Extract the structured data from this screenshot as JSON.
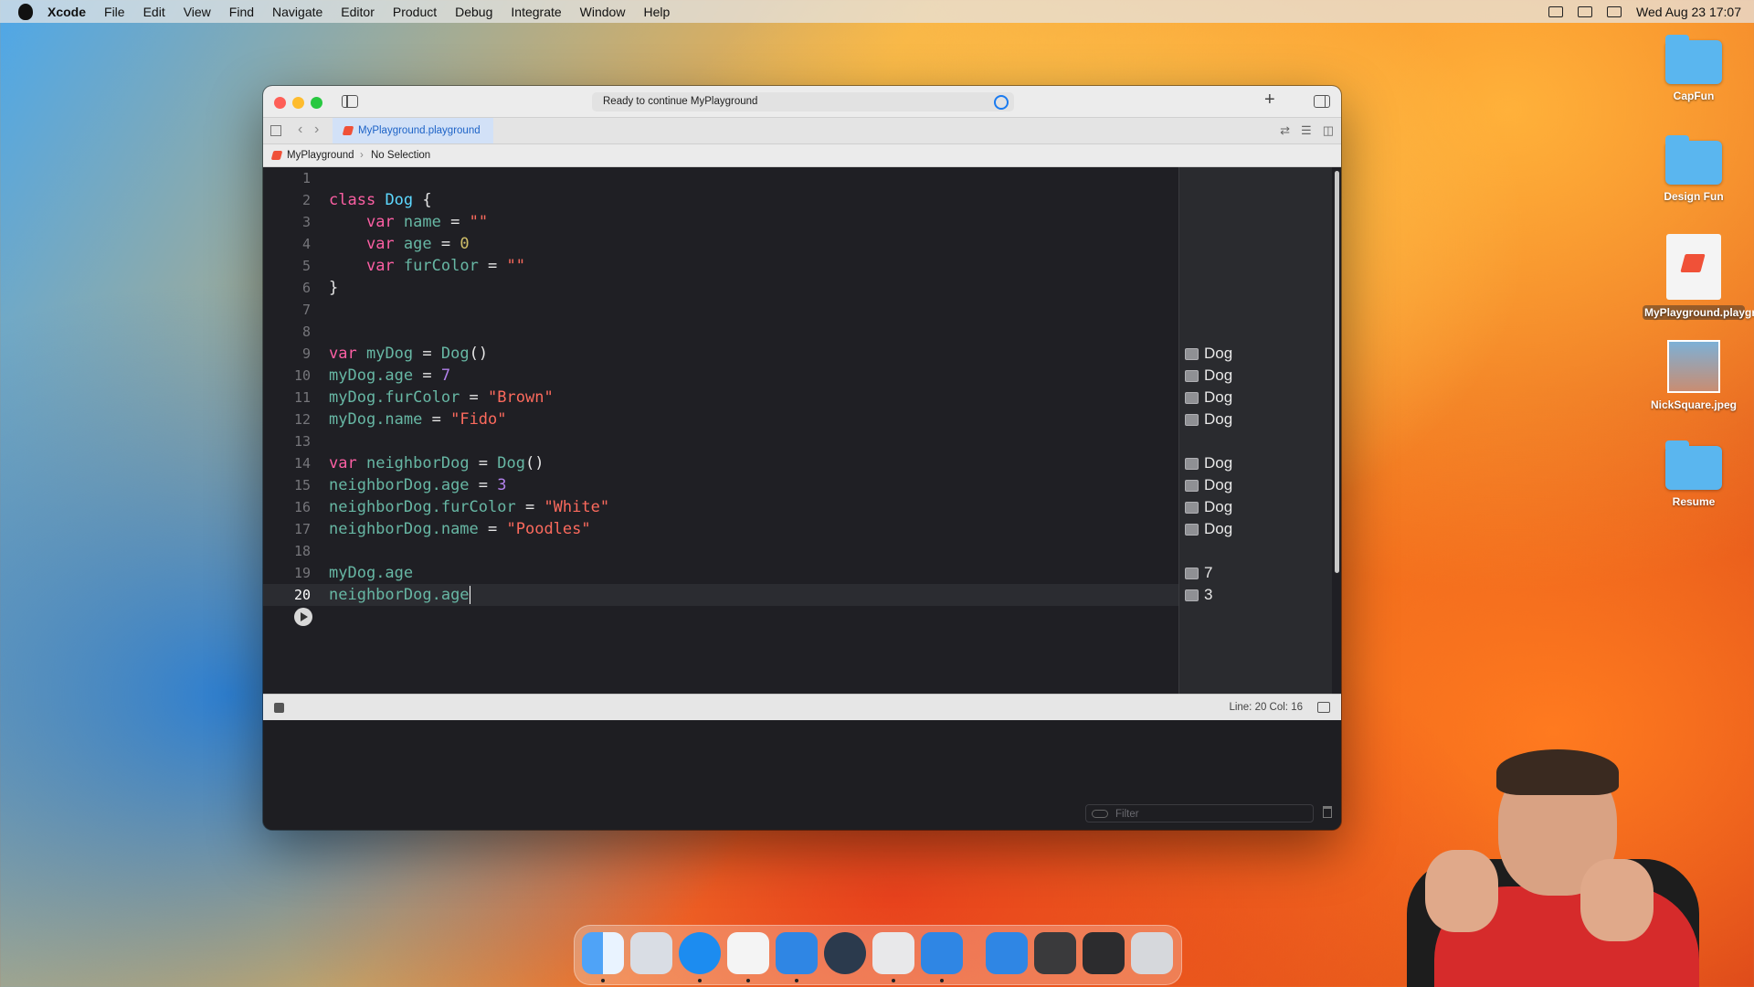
{
  "menubar": {
    "app": "Xcode",
    "items": [
      "File",
      "Edit",
      "View",
      "Find",
      "Navigate",
      "Editor",
      "Product",
      "Debug",
      "Integrate",
      "Window",
      "Help"
    ],
    "clock": "Wed Aug 23  17:07"
  },
  "window": {
    "activity": "Ready to continue MyPlayground",
    "tab": "MyPlayground.playground",
    "jumpbar": {
      "project": "MyPlayground",
      "selection": "No Selection"
    }
  },
  "editor": {
    "current_line": 20,
    "line_numbers": [
      "1",
      "2",
      "3",
      "4",
      "5",
      "6",
      "7",
      "8",
      "9",
      "10",
      "11",
      "12",
      "13",
      "14",
      "15",
      "16",
      "17",
      "18",
      "19",
      "20"
    ],
    "results": [
      {
        "line": 9,
        "value": "Dog"
      },
      {
        "line": 10,
        "value": "Dog"
      },
      {
        "line": 11,
        "value": "Dog"
      },
      {
        "line": 12,
        "value": "Dog"
      },
      {
        "line": 14,
        "value": "Dog"
      },
      {
        "line": 15,
        "value": "Dog"
      },
      {
        "line": 16,
        "value": "Dog"
      },
      {
        "line": 17,
        "value": "Dog"
      },
      {
        "line": 19,
        "value": "7"
      },
      {
        "line": 20,
        "value": "3"
      }
    ]
  },
  "code": {
    "l2": {
      "kw": "class",
      "type": "Dog",
      "rest": " {"
    },
    "l3": {
      "kw": "var",
      "id": "name",
      "eq": " = ",
      "str": "\"\""
    },
    "l4": {
      "kw": "var",
      "id": "age",
      "eq": " = ",
      "num": "0"
    },
    "l5": {
      "kw": "var",
      "id": "furColor",
      "eq": " = ",
      "str": "\"\""
    },
    "l6": {
      "text": "}"
    },
    "l9": {
      "kw": "var",
      "id": "myDog",
      "eq": " = ",
      "type": "Dog",
      "call": "()"
    },
    "l10": {
      "obj": "myDog",
      "prop": ".age",
      "eq": " = ",
      "num": "7"
    },
    "l11": {
      "obj": "myDog",
      "prop": ".furColor",
      "eq": " = ",
      "str": "\"Brown\""
    },
    "l12": {
      "obj": "myDog",
      "prop": ".name",
      "eq": " = ",
      "str": "\"Fido\""
    },
    "l14": {
      "kw": "var",
      "id": "neighborDog",
      "eq": " = ",
      "type": "Dog",
      "call": "()"
    },
    "l15": {
      "obj": "neighborDog",
      "prop": ".age",
      "eq": " = ",
      "num": "3"
    },
    "l16": {
      "obj": "neighborDog",
      "prop": ".furColor",
      "eq": " = ",
      "str": "\"White\""
    },
    "l17": {
      "obj": "neighborDog",
      "prop": ".name",
      "eq": " = ",
      "str": "\"Poodles\""
    },
    "l19": {
      "obj": "myDog",
      "prop": ".age"
    },
    "l20": {
      "obj": "neighborDog",
      "prop": ".age"
    }
  },
  "statusbar": {
    "position": "Line: 20  Col: 16"
  },
  "console": {
    "filter_placeholder": "Filter"
  },
  "desktop": [
    "CapFun",
    "Design Fun",
    "MyPlayground.playground",
    "NickSquare.jpeg",
    "Resume"
  ],
  "colors": {
    "keyword": "#fc5fa3",
    "type": "#5dd8ff",
    "identifier": "#67b7a4",
    "string": "#fc6a5d",
    "number": "#d0bf69",
    "editor_bg": "#1f1f24",
    "accent": "#1a7bf0"
  }
}
